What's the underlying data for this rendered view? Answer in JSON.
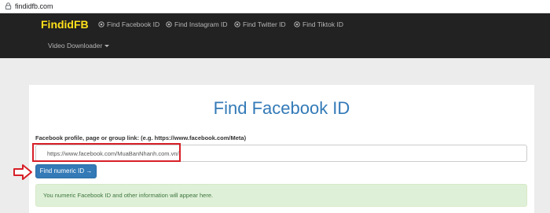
{
  "browser": {
    "url": "findidfb.com",
    "lock_icon": "lock-icon"
  },
  "navbar": {
    "brand": "FindidFB",
    "brand_color": "#ffe11a",
    "items": [
      {
        "label": "Find Facebook ID",
        "icon": "circle-dot-icon"
      },
      {
        "label": "Find Instagram ID",
        "icon": "circle-dot-icon"
      },
      {
        "label": "Find Twitter ID",
        "icon": "circle-dot-icon"
      },
      {
        "label": "Find Tiktok ID",
        "icon": "circle-dot-icon"
      }
    ],
    "dropdown_label": "Video Downloader"
  },
  "main": {
    "title": "Find Facebook ID",
    "title_color": "#337ab7",
    "input_label": "Facebook profile, page or group link: (e.g. https://www.facebook.com/Meta)",
    "input_value": "https://www.facebook.com/MuaBanNhanh.com.vn/",
    "submit_label": "Find numeric ID →",
    "submit_color": "#337ab7",
    "info_text": "You numeric Facebook ID and other information will appear here.",
    "annotation_color": "#d71f27"
  }
}
